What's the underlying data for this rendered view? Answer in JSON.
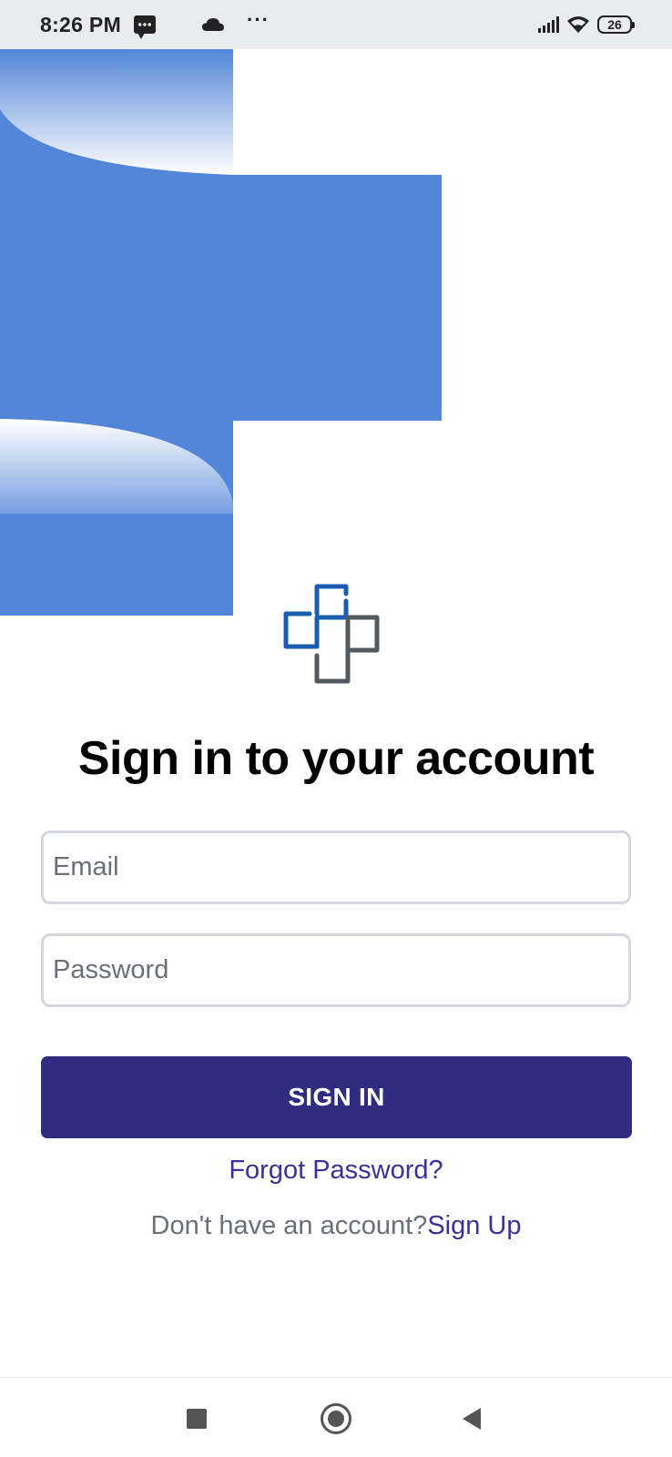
{
  "status_bar": {
    "time": "8:26 PM",
    "battery": "26",
    "icons": [
      "message-icon",
      "cloud-icon",
      "more-icon",
      "signal-icon",
      "wifi-icon",
      "battery-icon"
    ]
  },
  "colors": {
    "hero_blue": "#5385d8",
    "primary": "#302c80",
    "link": "#3e2f9a",
    "logo_blue": "#1a5cb0",
    "logo_gray": "#555a60"
  },
  "main": {
    "title": "Sign in to your account",
    "email_placeholder": "Email",
    "password_placeholder": "Password",
    "signin_label": "SIGN IN",
    "forgot_label": "Forgot Password?",
    "no_account_text": "Don't have an account?",
    "signup_label": "Sign Up"
  },
  "nav_bar": {
    "icons": [
      "recent-apps-icon",
      "home-icon",
      "back-icon"
    ]
  }
}
